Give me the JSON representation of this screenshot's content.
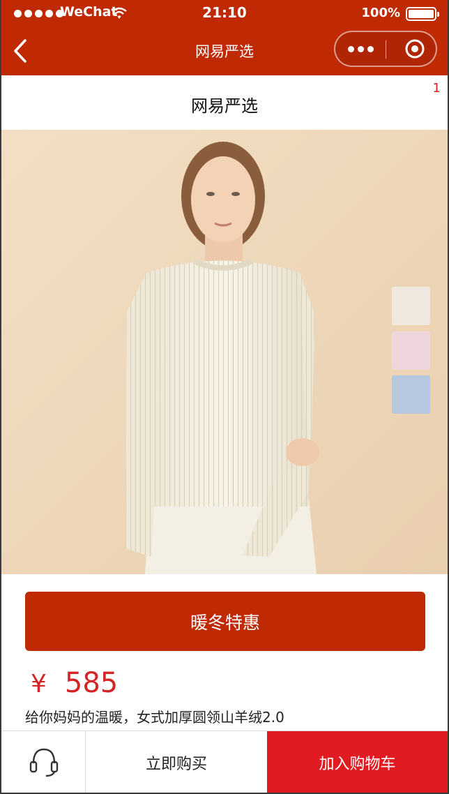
{
  "status_bar": {
    "carrier": "WeChat",
    "time": "21:10",
    "battery_percent": "100%"
  },
  "nav": {
    "title": "网易严选",
    "back_icon": "chevron-left-icon",
    "more_icon": "more-dots-icon",
    "close_icon": "target-circle-icon"
  },
  "page": {
    "shop_title": "网易严选",
    "corner_badge": "1"
  },
  "product": {
    "image_subject": "woman-wearing-cream-knit-sweater",
    "swatches": [
      "#f1e9df",
      "#eed6dc",
      "#b5c8df"
    ],
    "promo_label": "暖冬特惠",
    "currency": "¥",
    "price": "585",
    "description": "给你妈妈的温暖，女式加厚圆领山羊绒2.0"
  },
  "bottom_bar": {
    "service_icon": "headset-icon",
    "buy_now_label": "立即购买",
    "add_to_cart_label": "加入购物车"
  },
  "colors": {
    "brand": "#bf2a05",
    "cart": "#e01b21",
    "price": "#d42424"
  }
}
